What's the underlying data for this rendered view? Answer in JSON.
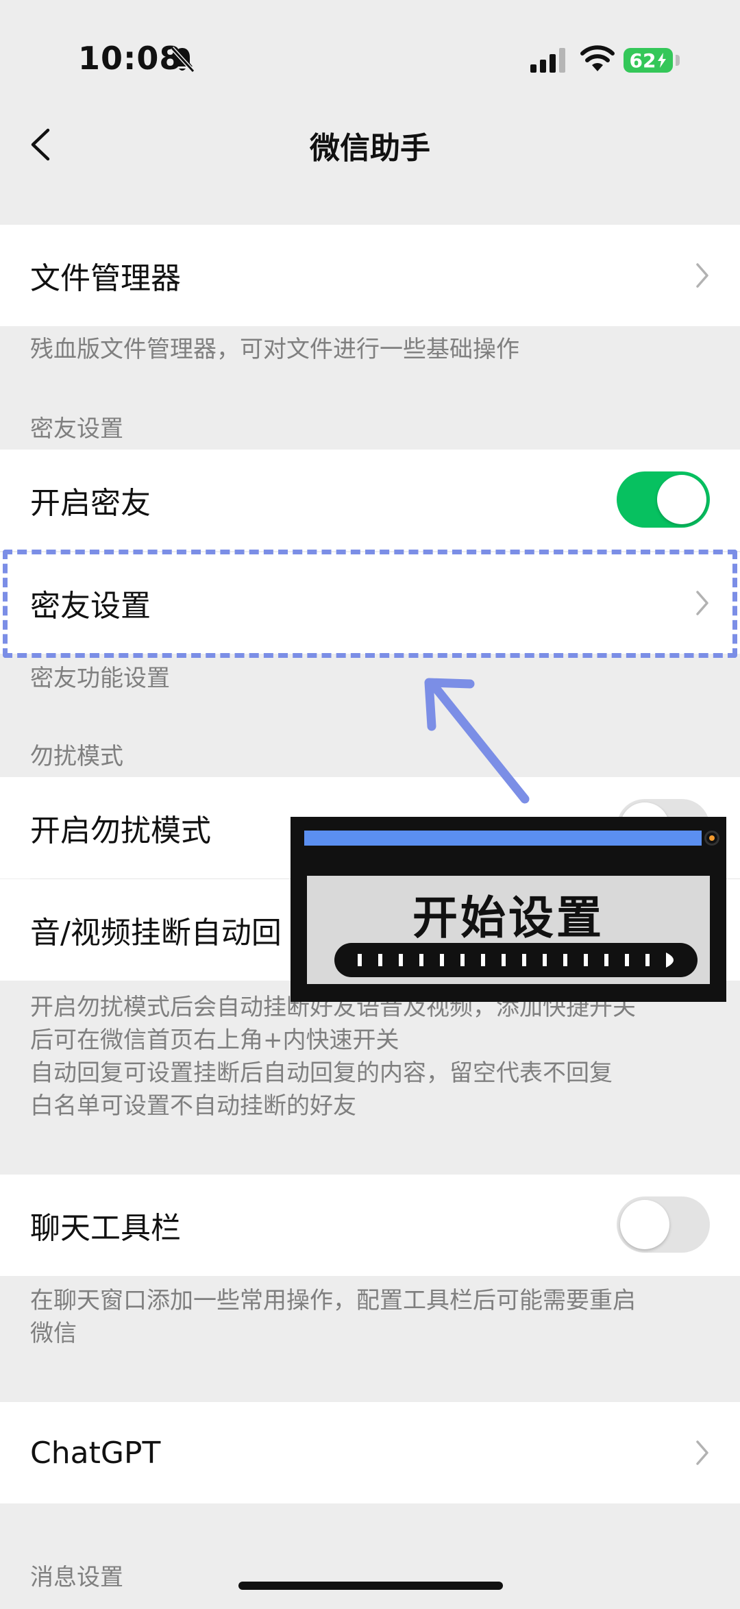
{
  "status_bar": {
    "time": "10:08",
    "battery": "62",
    "icons": [
      "bell-off-icon",
      "signal-icon",
      "wifi-icon",
      "battery-icon"
    ]
  },
  "nav": {
    "title": "微信助手"
  },
  "file_manager": {
    "label": "文件管理器",
    "note": "残血版文件管理器，可对文件进行一些基础操作"
  },
  "close_friend": {
    "header": "密友设置",
    "enable_label": "开启密友",
    "enable_on": true,
    "settings_label": "密友设置",
    "note": "密友功能设置"
  },
  "dnd": {
    "header": "勿扰模式",
    "enable_label": "开启勿扰模式",
    "auto_reply_label": "音/视频挂断自动回",
    "notes": [
      "开启勿扰模式后会自动挂断好友语音及视频，添加快捷开关",
      "后可在微信首页右上角+内快速开关",
      "自动回复可设置挂断后自动回复的内容，留空代表不回复",
      "白名单可设置不自动挂断的好友"
    ]
  },
  "toolbar": {
    "label": "聊天工具栏",
    "enabled": false,
    "notes": [
      "在聊天窗口添加一些常用操作，配置工具栏后可能需要重启",
      "微信"
    ]
  },
  "chatgpt": {
    "label": "ChatGPT"
  },
  "message_settings": {
    "header": "消息设置"
  },
  "overlay": {
    "title": "开始设置"
  },
  "colors": {
    "accent_green": "#07c160",
    "highlight_blue": "#7b8ee6",
    "card_bar_blue": "#5b8ff0",
    "background": "#ededed"
  }
}
